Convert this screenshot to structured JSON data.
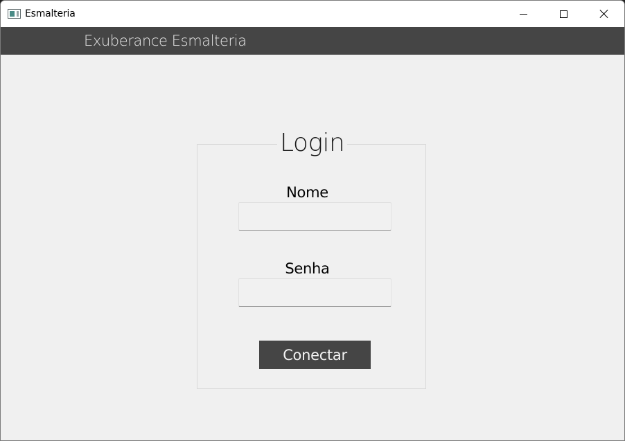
{
  "window": {
    "title": "Esmalteria",
    "icon": "app-window-icon",
    "controls": {
      "minimize_icon": "minimize-icon",
      "maximize_icon": "maximize-icon",
      "close_icon": "close-icon"
    }
  },
  "header": {
    "title": "Exuberance Esmalteria"
  },
  "login": {
    "legend": "Login",
    "name_label": "Nome",
    "name_value": "",
    "password_label": "Senha",
    "password_value": "",
    "submit_label": "Conectar"
  },
  "colors": {
    "header_band": "#454545",
    "window_bg": "#f0f0f0",
    "button_bg": "#454545",
    "button_text": "#f2f2f2"
  }
}
